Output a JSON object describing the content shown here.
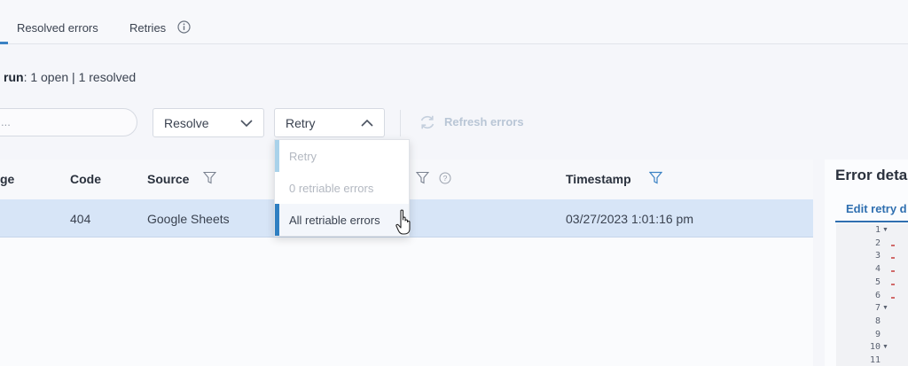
{
  "tabs": {
    "resolved_label": "Resolved errors",
    "retries_label": "Retries"
  },
  "summary": {
    "prefix": "run",
    "counts": ": 1 open | 1 resolved"
  },
  "toolbar": {
    "search_placeholder": "...",
    "resolve_label": "Resolve",
    "retry_label": "Retry",
    "refresh_label": "Refresh errors"
  },
  "retry_menu": {
    "items": [
      {
        "label": "Retry",
        "state": "disabled"
      },
      {
        "label": "0 retriable errors",
        "state": "disabled"
      },
      {
        "label": "All retriable errors",
        "state": "hovered"
      }
    ]
  },
  "table": {
    "columns": {
      "first": "ge",
      "code": "Code",
      "source": "Source",
      "timestamp": "Timestamp"
    },
    "rows": [
      {
        "code": "404",
        "source": "Google Sheets",
        "timestamp": "03/27/2023 1:01:16 pm"
      }
    ]
  },
  "panel": {
    "title": "Error deta",
    "tab": "Edit retry d",
    "line_numbers": [
      "1",
      "2",
      "3",
      "4",
      "5",
      "6",
      "7",
      "8",
      "9",
      "10",
      "11"
    ]
  },
  "colors": {
    "accent": "#2f7fc2",
    "selected_row": "#d7e5f7",
    "disabled_text": "#b3b8c1"
  }
}
